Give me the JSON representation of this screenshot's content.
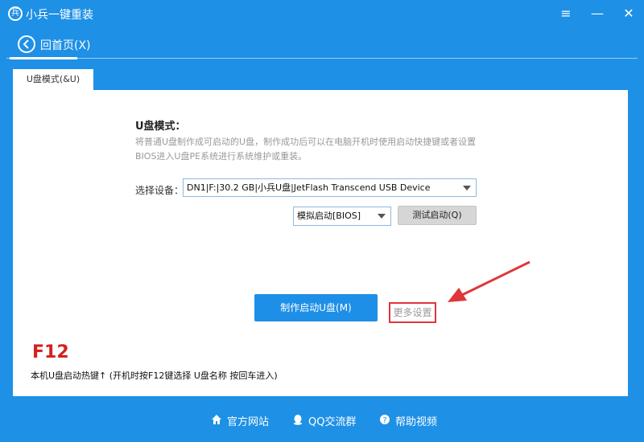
{
  "window": {
    "title": "小兵一键重装",
    "minimize": "≡",
    "restore": "—",
    "close": "✕"
  },
  "nav": {
    "back_label": "回首页(X)"
  },
  "tab": {
    "label": "U盘模式(&U)"
  },
  "panel": {
    "title": "U盘模式：",
    "description": "将普通U盘制作成可启动的U盘，制作成功后可以在电脑开机时使用启动快捷键或者设置BIOS进入U盘PE系统进行系统维护或重装。",
    "device_label": "选择设备：",
    "device_selected": "DN1|F:|30.2 GB|小兵U盘|JetFlash Transcend USB Device",
    "boot_mode_selected": "模拟启动[BIOS]",
    "test_button": "测试启动(Q)",
    "make_button": "制作启动U盘(M)",
    "more_settings": "更多设置",
    "hotkey": "F12",
    "hotkey_desc": "本机U盘启动热键↑ (开机时按F12键选择 U盘名称 按回车进入)"
  },
  "footer": {
    "official_site": "官方网站",
    "qq_group": "QQ交流群",
    "help_video": "帮助视频"
  },
  "colors": {
    "background": "#1e90e6",
    "accent": "#1e8fe6",
    "highlight": "#e0363a",
    "hotkey": "#d61f1f"
  }
}
